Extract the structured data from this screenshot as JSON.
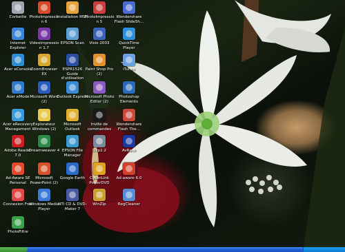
{
  "desktop": {
    "icons": [
      {
        "label": "Corbeille",
        "icon": "recycle-bin-icon",
        "color": "#9ea7b0"
      },
      {
        "label": "PhotoImpression 6",
        "icon": "photoimpression-icon",
        "color": "#d64a2a"
      },
      {
        "label": "Installation MSN",
        "icon": "msn-butterfly-icon",
        "color": "#e8a23a"
      },
      {
        "label": "PhotoImpression 5",
        "icon": "photoimpression-icon",
        "color": "#c93f3f"
      },
      {
        "label": "Wondershare Flash SlideSh...",
        "icon": "wondershare-icon",
        "color": "#4a6cd0"
      },
      {
        "label": "Internet Explorer",
        "icon": "internet-explorer-icon",
        "color": "#3a86d6"
      },
      {
        "label": "VideoImpression 1.7",
        "icon": "videoimpression-icon",
        "color": "#7a3aa6"
      },
      {
        "label": "EPSON Scan",
        "icon": "scanner-icon",
        "color": "#5e9fd4"
      },
      {
        "label": "Visio 2003",
        "icon": "visio-icon",
        "color": "#3b64b8"
      },
      {
        "label": "QuickTime Player",
        "icon": "quicktime-icon",
        "color": "#2d8fd8"
      },
      {
        "label": "Acer eConsole",
        "icon": "acer-econsole-icon",
        "color": "#2f8cd0"
      },
      {
        "label": "ZoomBrowser EX",
        "icon": "zoombrowser-icon",
        "color": "#d6a830"
      },
      {
        "label": "ESPR1526 Guide d'utilisation",
        "icon": "epson-guide-icon",
        "color": "#2b4fa0"
      },
      {
        "label": "Paint Shop Pro (2)",
        "icon": "paint-shop-pro-icon",
        "color": "#e0902a"
      },
      {
        "label": "iTunes",
        "icon": "itunes-icon",
        "color": "#6a9fe0"
      },
      {
        "label": "Acer eMode",
        "icon": "acer-emode-icon",
        "color": "#2f7bc8"
      },
      {
        "label": "Microsoft Word (2)",
        "icon": "word-icon",
        "color": "#2b5bb8"
      },
      {
        "label": "Outlook Express",
        "icon": "outlook-express-icon",
        "color": "#3a8ad8"
      },
      {
        "label": "Microsoft Photo Editor (2)",
        "icon": "photo-editor-icon",
        "color": "#8a5ac0"
      },
      {
        "label": "Photoshop Elements",
        "icon": "photoshop-elements-icon",
        "color": "#2a6ab8"
      },
      {
        "label": "Acer eRecovery Management",
        "icon": "acer-erecovery-icon",
        "color": "#3a9ad8"
      },
      {
        "label": "Explorateur Windows (2)",
        "icon": "folder-icon",
        "color": "#e8c84a"
      },
      {
        "label": "Microsoft Outlook",
        "icon": "outlook-icon",
        "color": "#e0b030"
      },
      {
        "label": "Invite de commandes",
        "icon": "command-prompt-icon",
        "color": "#1a1a1a"
      },
      {
        "label": "Wondershare Flash The...",
        "icon": "wondershare-icon",
        "color": "#c84a3a"
      },
      {
        "label": "Adobe Reader 7.0",
        "icon": "adobe-reader-icon",
        "color": "#c82020"
      },
      {
        "label": "Dreamweaver 4",
        "icon": "dreamweaver-icon",
        "color": "#2a8a4a"
      },
      {
        "label": "EPSON File Manager",
        "icon": "epson-file-manager-icon",
        "color": "#3a9ad0"
      },
      {
        "label": "Dxp2.2",
        "icon": "dxp-icon",
        "color": "#7a8a9a"
      },
      {
        "label": "AvRack",
        "icon": "avrack-icon",
        "color": "#1a3aa0"
      },
      {
        "label": "Ad-Aware SE Personal",
        "icon": "ad-aware-icon",
        "color": "#e04a2a"
      },
      {
        "label": "Microsoft PowerPoint (2)",
        "icon": "powerpoint-icon",
        "color": "#d2532a"
      },
      {
        "label": "Google Earth",
        "icon": "google-earth-icon",
        "color": "#2a6ac8"
      },
      {
        "label": "CyberLink PowerDVD",
        "icon": "powerdvd-icon",
        "color": "#e0a020"
      },
      {
        "label": "Ad-aware 6.0",
        "icon": "ad-aware-icon",
        "color": "#d0402a"
      },
      {
        "label": "Connexion Free",
        "icon": "connexion-free-icon",
        "color": "#e04848"
      },
      {
        "label": "Windows Media Player",
        "icon": "windows-media-player-icon",
        "color": "#3a7ad8"
      },
      {
        "label": "NTI CD & DVD-Maker 7",
        "icon": "nti-cd-maker-icon",
        "color": "#4a5aa0"
      },
      {
        "label": "WinZip",
        "icon": "winzip-icon",
        "color": "#c8a030"
      },
      {
        "label": "RegCleaner",
        "icon": "regcleaner-icon",
        "color": "#5a8ad0"
      },
      {
        "label": "PhotoFiltre",
        "icon": "photofiltre-icon",
        "color": "#3aa04a"
      }
    ]
  },
  "taskbar": {
    "start": {
      "icon": "windows-start-icon"
    },
    "tray": {
      "icon": "system-tray-icon"
    }
  }
}
